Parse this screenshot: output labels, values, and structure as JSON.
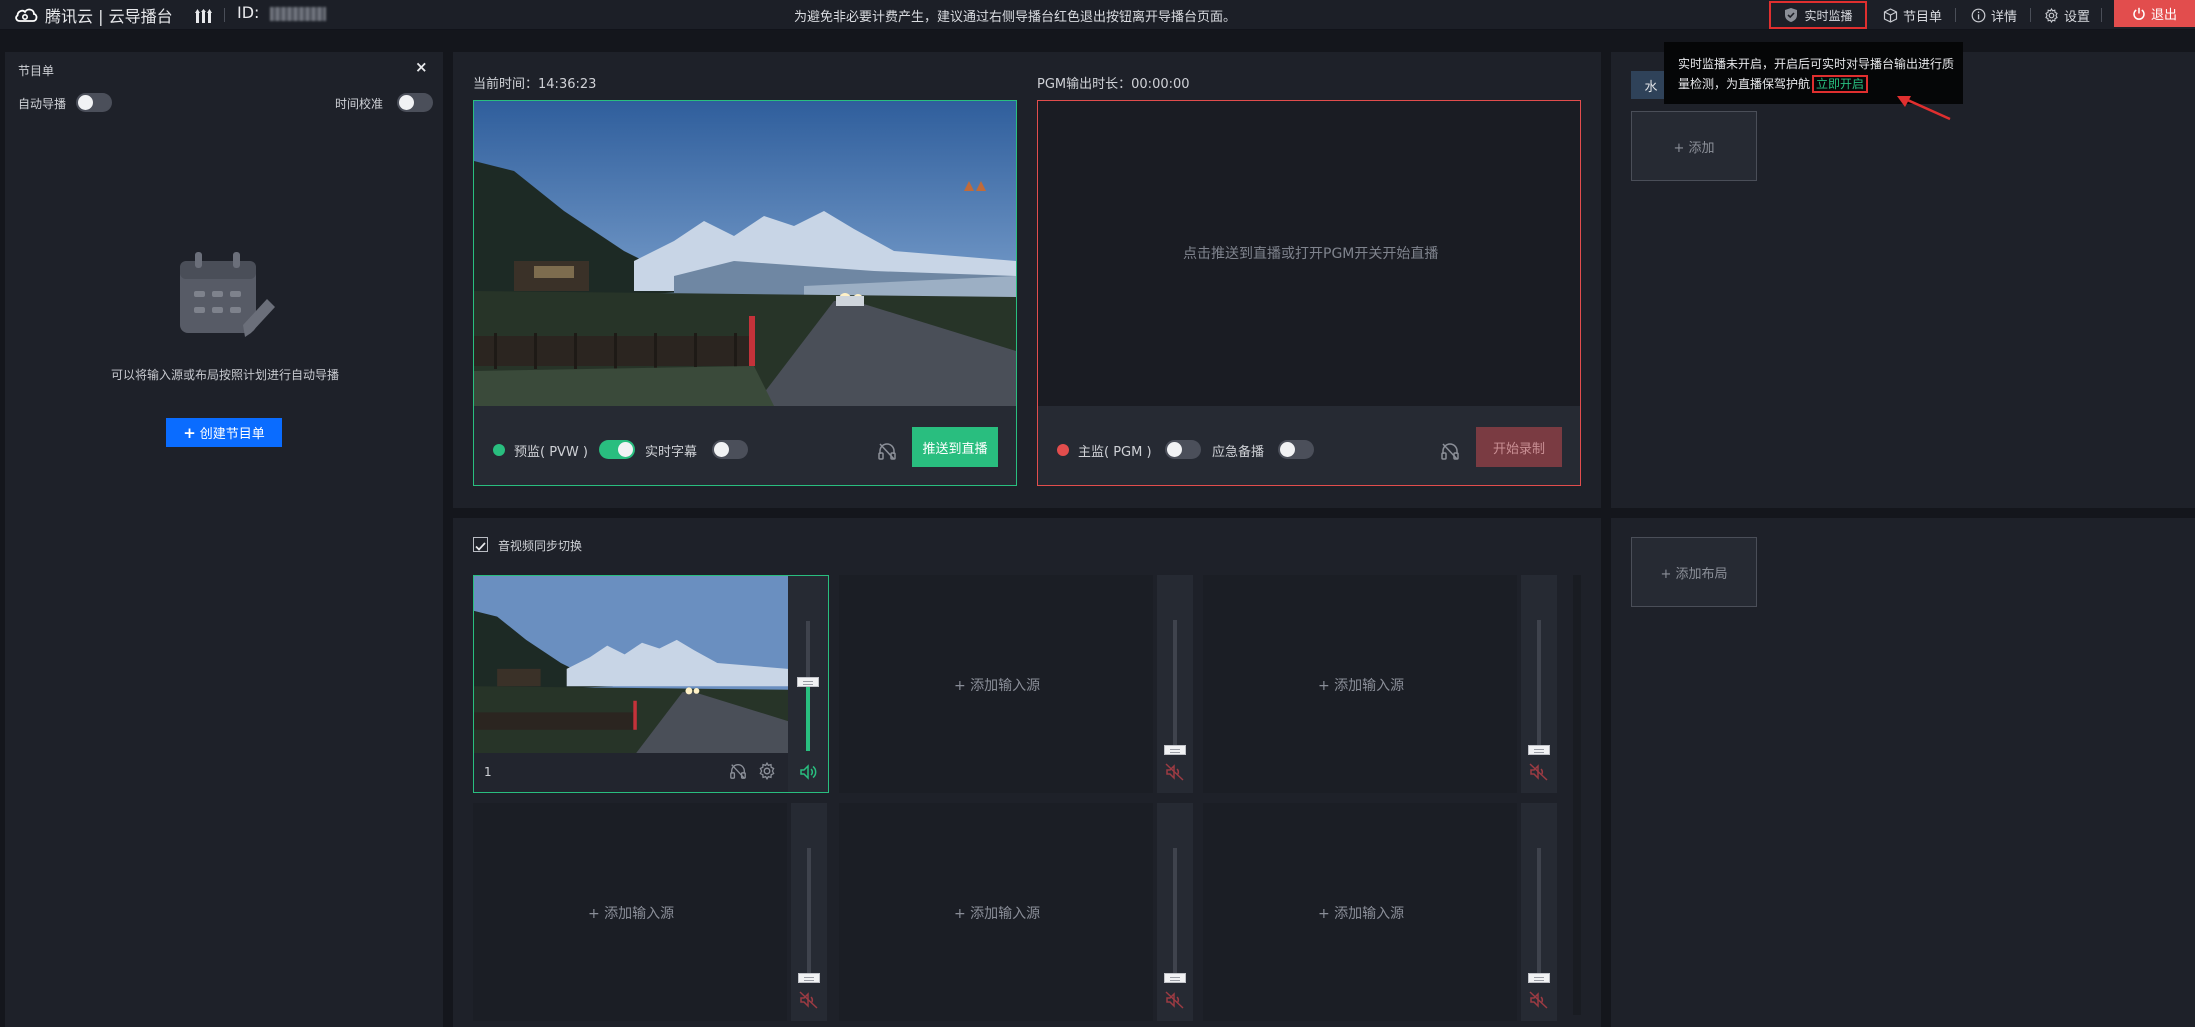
{
  "topbar": {
    "brand": "腾讯云 | 云导播台",
    "id_label": "ID:",
    "notice": "为避免非必要计费产生，建议通过右侧导播台红色退出按钮离开导播台页面。",
    "realtime_monitor": "实时监播",
    "program_list": "节目单",
    "details": "详情",
    "settings": "设置",
    "exit": "退出"
  },
  "tooltip": {
    "text": "实时监播未开启，开启后可实时对导播台输出进行质量检测，为直播保驾护航",
    "link": "立即开启"
  },
  "left_panel": {
    "title": "节目单",
    "close": "×",
    "auto_switch_label": "自动导播",
    "auto_switch_on": false,
    "time_calibration_label": "时间校准",
    "time_calibration_on": false,
    "empty_text": "可以将输入源或布局按照计划进行自动导播",
    "create_button": "创建节目单",
    "create_plus": "+"
  },
  "preview": {
    "current_time_label": "当前时间：",
    "current_time": "14:36:23",
    "status_label": "预监( PVW )",
    "status_on": true,
    "subtitle_label": "实时字幕",
    "subtitle_on": false,
    "push_button": "推送到直播",
    "status_color": "#29be7f"
  },
  "program": {
    "output_label": "PGM输出时长：",
    "output_duration": "00:00:00",
    "placeholder": "点击推送到直播或打开PGM开关开始直播",
    "status_label": "主监( PGM )",
    "status_on": false,
    "backup_label": "应急备播",
    "backup_on": false,
    "record_button": "开始录制",
    "status_color": "#e24d4d"
  },
  "right_top": {
    "tab_label": "水",
    "add_label": "+ 添加"
  },
  "right_bottom": {
    "add_layout_label": "+ 添加布局"
  },
  "sources": {
    "sync_label": "音视频同步切换",
    "sync_checked": true,
    "source1_index": "1",
    "add_source_label": "+ 添加输入源"
  }
}
